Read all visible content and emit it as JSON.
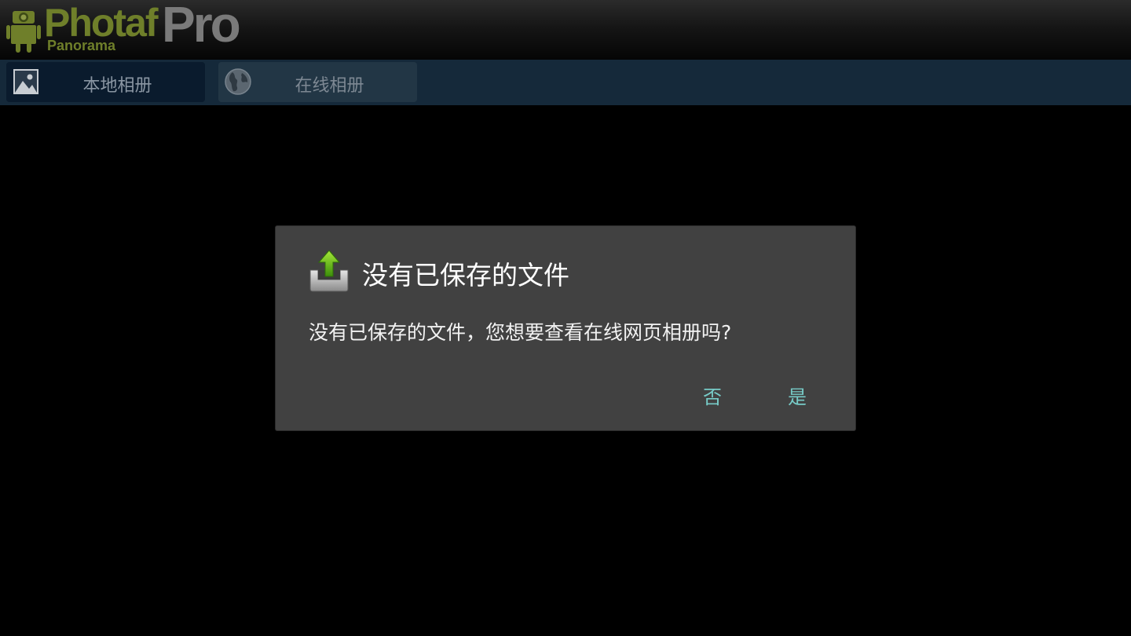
{
  "app": {
    "logo_main": "Photaf",
    "logo_pro": "Pro",
    "logo_sub": "Panorama"
  },
  "tabs": [
    {
      "label": "本地相册",
      "icon": "image-icon",
      "selected": true
    },
    {
      "label": "在线相册",
      "icon": "globe-icon",
      "selected": false
    }
  ],
  "dialog": {
    "icon": "upload-icon",
    "title": "没有已保存的文件",
    "message": "没有已保存的文件，您想要查看在线网页相册吗?",
    "no_label": "否",
    "yes_label": "是"
  },
  "colors": {
    "tabbar_bg": "#15293a",
    "dialog_bg": "#414141",
    "button_text": "#77cbc7",
    "logo_green": "#6f7f2a",
    "upload_arrow": "#6fbf1a"
  }
}
